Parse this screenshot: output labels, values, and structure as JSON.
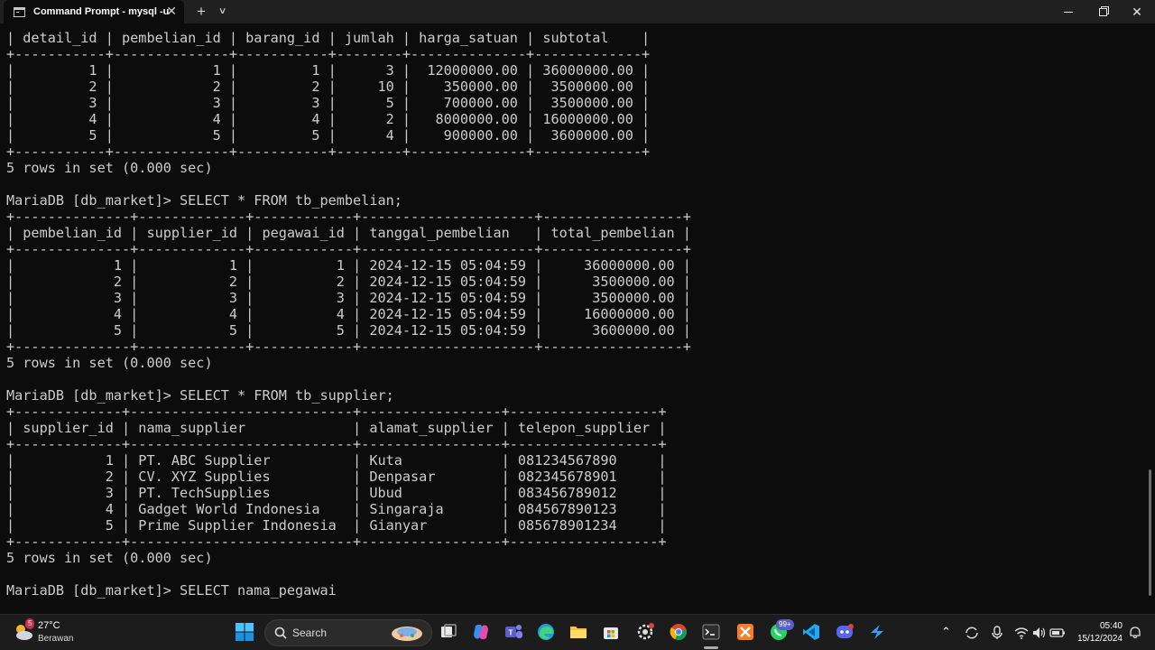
{
  "window": {
    "tab_title": "Command Prompt - mysql  -u",
    "tab_close_glyph": "✕",
    "new_tab_glyph": "+",
    "tab_menu_glyph": "∨",
    "close_glyph": "✕"
  },
  "terminal": {
    "lines": [
      "| detail_id | pembelian_id | barang_id | jumlah | harga_satuan | subtotal    |",
      "+-----------+--------------+-----------+--------+--------------+-------------+",
      "|         1 |            1 |         1 |      3 |  12000000.00 | 36000000.00 |",
      "|         2 |            2 |         2 |     10 |    350000.00 |  3500000.00 |",
      "|         3 |            3 |         3 |      5 |    700000.00 |  3500000.00 |",
      "|         4 |            4 |         4 |      2 |   8000000.00 | 16000000.00 |",
      "|         5 |            5 |         5 |      4 |    900000.00 |  3600000.00 |",
      "+-----------+--------------+-----------+--------+--------------+-------------+",
      "5 rows in set (0.000 sec)",
      "",
      "MariaDB [db_market]> SELECT * FROM tb_pembelian;",
      "+--------------+-------------+------------+---------------------+-----------------+",
      "| pembelian_id | supplier_id | pegawai_id | tanggal_pembelian   | total_pembelian |",
      "+--------------+-------------+------------+---------------------+-----------------+",
      "|            1 |           1 |          1 | 2024-12-15 05:04:59 |     36000000.00 |",
      "|            2 |           2 |          2 | 2024-12-15 05:04:59 |      3500000.00 |",
      "|            3 |           3 |          3 | 2024-12-15 05:04:59 |      3500000.00 |",
      "|            4 |           4 |          4 | 2024-12-15 05:04:59 |     16000000.00 |",
      "|            5 |           5 |          5 | 2024-12-15 05:04:59 |      3600000.00 |",
      "+--------------+-------------+------------+---------------------+-----------------+",
      "5 rows in set (0.000 sec)",
      "",
      "MariaDB [db_market]> SELECT * FROM tb_supplier;",
      "+-------------+---------------------------+-----------------+------------------+",
      "| supplier_id | nama_supplier             | alamat_supplier | telepon_supplier |",
      "+-------------+---------------------------+-----------------+------------------+",
      "|           1 | PT. ABC Supplier          | Kuta            | 081234567890     |",
      "|           2 | CV. XYZ Supplies          | Denpasar        | 082345678901     |",
      "|           3 | PT. TechSupplies          | Ubud            | 083456789012     |",
      "|           4 | Gadget World Indonesia    | Singaraja       | 084567890123     |",
      "|           5 | Prime Supplier Indonesia  | Gianyar         | 085678901234     |",
      "+-------------+---------------------------+-----------------+------------------+",
      "5 rows in set (0.000 sec)",
      "",
      "MariaDB [db_market]> SELECT nama_pegawai"
    ]
  },
  "taskbar": {
    "weather": {
      "temp": "27°C",
      "desc": "Berawan",
      "badge": "5"
    },
    "search": {
      "label": "Search"
    },
    "whatsapp_badge": "99+",
    "clock": {
      "time": "05:40",
      "date": "15/12/2024"
    },
    "accent": "#0078d4"
  }
}
